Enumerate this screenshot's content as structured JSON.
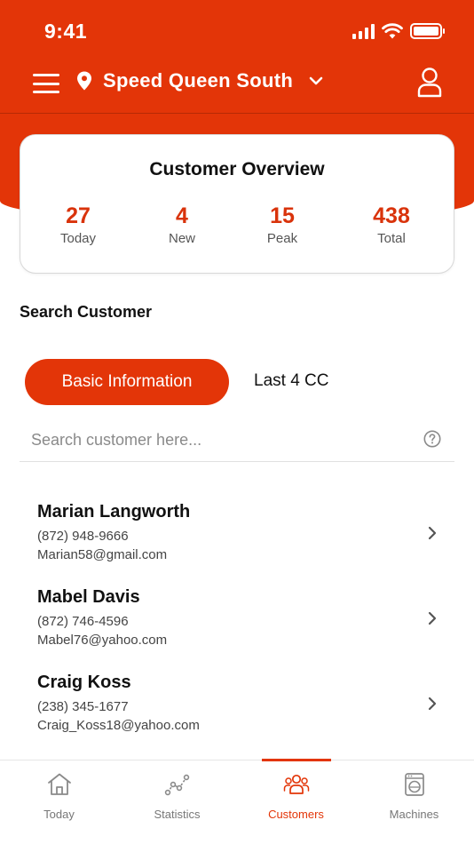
{
  "status_bar": {
    "time": "9:41"
  },
  "header": {
    "location": "Speed Queen South",
    "accent": "#e33508"
  },
  "overview": {
    "title": "Customer Overview",
    "stats": [
      {
        "value": "27",
        "label": "Today"
      },
      {
        "value": "4",
        "label": "New"
      },
      {
        "value": "15",
        "label": "Peak"
      },
      {
        "value": "438",
        "label": "Total"
      }
    ]
  },
  "search_section": {
    "title": "Search Customer",
    "tabs": [
      {
        "label": "Basic Information",
        "active": true
      },
      {
        "label": "Last 4 CC",
        "active": false
      }
    ],
    "placeholder": "Search customer here...",
    "value": ""
  },
  "customers": [
    {
      "name": "Marian Langworth",
      "phone": "(872) 948-9666",
      "email": "Marian58@gmail.com"
    },
    {
      "name": "Mabel Davis",
      "phone": "(872) 746-4596",
      "email": "Mabel76@yahoo.com"
    },
    {
      "name": "Craig Koss",
      "phone": "(238) 345-1677",
      "email": "Craig_Koss18@yahoo.com"
    }
  ],
  "tabbar": {
    "items": [
      {
        "label": "Today",
        "icon": "home-icon"
      },
      {
        "label": "Statistics",
        "icon": "statistics-icon"
      },
      {
        "label": "Customers",
        "icon": "customers-icon",
        "active": true
      },
      {
        "label": "Machines",
        "icon": "washing-machine-icon"
      }
    ]
  }
}
